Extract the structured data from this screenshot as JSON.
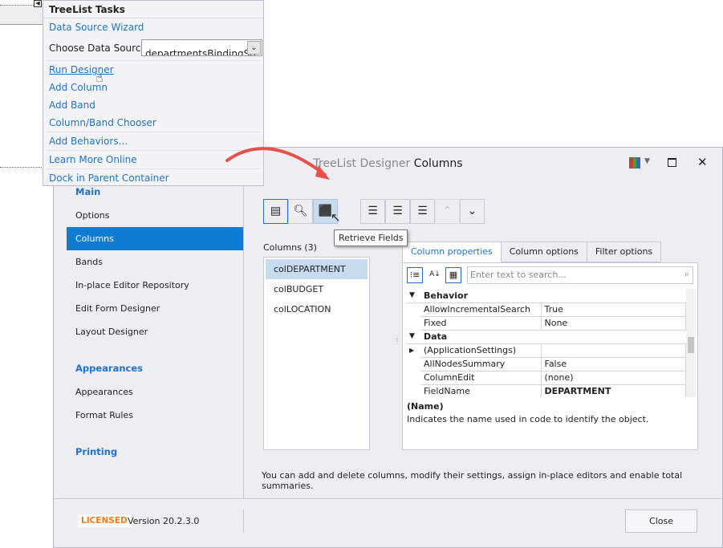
{
  "tasks": {
    "title": "TreeList Tasks",
    "data_source_wizard": "Data Source Wizard",
    "choose_label": "Choose Data Source",
    "data_source_value": "departmentsBindingSo",
    "run_designer": "Run Designer",
    "add_column": "Add Column",
    "add_band": "Add Band",
    "chooser": "Column/Band Chooser",
    "add_behaviors": "Add Behaviors...",
    "learn_more": "Learn More Online",
    "dock": "Dock in Parent Container"
  },
  "dialog": {
    "title_prefix": "TreeList Designer",
    "title_page": "Columns",
    "sidebar": {
      "main": "Main",
      "main_items": [
        "Options",
        "Columns",
        "Bands",
        "In-place Editor Repository",
        "Edit Form Designer",
        "Layout Designer"
      ],
      "appearances": "Appearances",
      "app_items": [
        "Appearances",
        "Format Rules"
      ],
      "printing": "Printing"
    },
    "tooltip": "Retrieve Fields",
    "columns_label": "Columns (3)",
    "columns": [
      "colDEPARTMENT",
      "colBUDGET",
      "colLOCATION"
    ],
    "tabs": [
      "Column properties",
      "Column options",
      "Filter options"
    ],
    "search_placeholder": "Enter text to search...",
    "properties": [
      {
        "category": "Behavior"
      },
      {
        "name": "AllowIncrementalSearch",
        "value": "True"
      },
      {
        "name": "Fixed",
        "value": "None"
      },
      {
        "category": "Data"
      },
      {
        "name": "(ApplicationSettings)",
        "value": "",
        "expandable": true
      },
      {
        "name": "AllNodesSummary",
        "value": "False"
      },
      {
        "name": "ColumnEdit",
        "value": "(none)"
      },
      {
        "name": "FieldName",
        "value": "DEPARTMENT",
        "bold": true
      }
    ],
    "desc_title": "(Name)",
    "desc_text": "Indicates the name used in code to identify the object.",
    "hint": "You can add and delete columns, modify their settings, assign in-place editors and enable total summaries.",
    "licensed": "LICENSED",
    "version": "Version 20.2.3.0",
    "close": "Close"
  },
  "colors": {
    "accent": "#1e73c8",
    "selected": "#0f7bd3",
    "arrow": "#e8504a",
    "licensed": "#f07c1e"
  }
}
